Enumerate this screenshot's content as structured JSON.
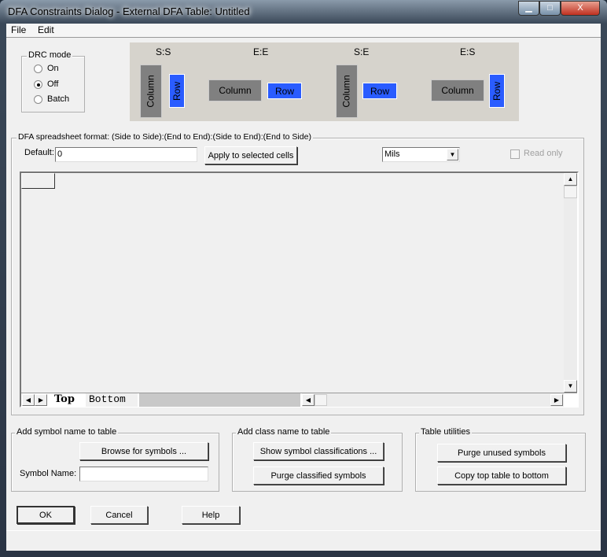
{
  "window": {
    "title": "DFA Constraints Dialog - External DFA Table: Untitled",
    "minimize": "▁",
    "maximize": "□",
    "close": "X"
  },
  "menu": [
    "File",
    "Edit"
  ],
  "drc_mode": {
    "label": "DRC mode",
    "options": [
      "On",
      "Off",
      "Batch"
    ],
    "selected": "Off"
  },
  "diagram": {
    "pairs": [
      {
        "label": "S:S",
        "column": "Column",
        "row": "Row"
      },
      {
        "label": "E:E",
        "column": "Column",
        "row": "Row"
      },
      {
        "label": "S:E",
        "column": "Column",
        "row": "Row"
      },
      {
        "label": "E:S",
        "column": "Column",
        "row": "Row"
      }
    ],
    "column_color": "#808080",
    "row_color": "#2a5cff"
  },
  "spreadsheet": {
    "label": "DFA spreadsheet format:  (Side to Side):(End to End):(Side to End):(End to Side)",
    "default_label": "Default:",
    "default_value": "0",
    "apply_button": "Apply to selected cells",
    "units": "Mils",
    "read_only": "Read only",
    "read_only_checked": false,
    "tabs": [
      "Top",
      "Bottom"
    ],
    "active_tab": "Top"
  },
  "symbol_group": {
    "label": "Add symbol name to table",
    "browse_button": "Browse for symbols ...",
    "symbol_name_label": "Symbol Name:",
    "symbol_name_value": ""
  },
  "class_group": {
    "label": "Add class name to table",
    "show_button": "Show symbol classifications ...",
    "purge_button": "Purge classified symbols"
  },
  "utilities_group": {
    "label": "Table utilities",
    "purge_unused_button": "Purge unused symbols",
    "copy_button": "Copy top table to bottom"
  },
  "footer": {
    "ok": "OK",
    "cancel": "Cancel",
    "help": "Help"
  }
}
